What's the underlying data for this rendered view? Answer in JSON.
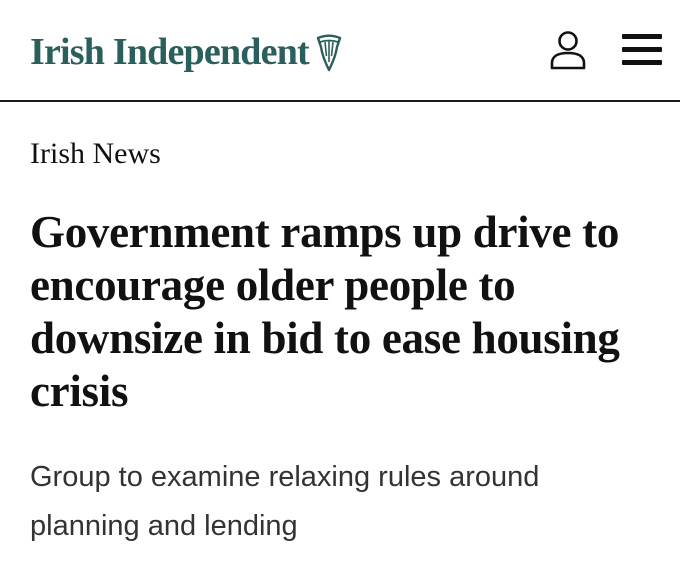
{
  "header": {
    "brand_name": "Irish Independent",
    "brand_color": "#2b5f5c",
    "logo_icon": "harp-icon",
    "account_icon": "user-icon",
    "menu_icon": "hamburger-menu-icon",
    "divider_color": "#1a1a1a"
  },
  "article": {
    "section": "Irish News",
    "headline": "Government ramps up drive to encourage older people to downsize in bid to ease housing crisis",
    "standfirst": "Group to examine relaxing rules around planning and lending"
  }
}
